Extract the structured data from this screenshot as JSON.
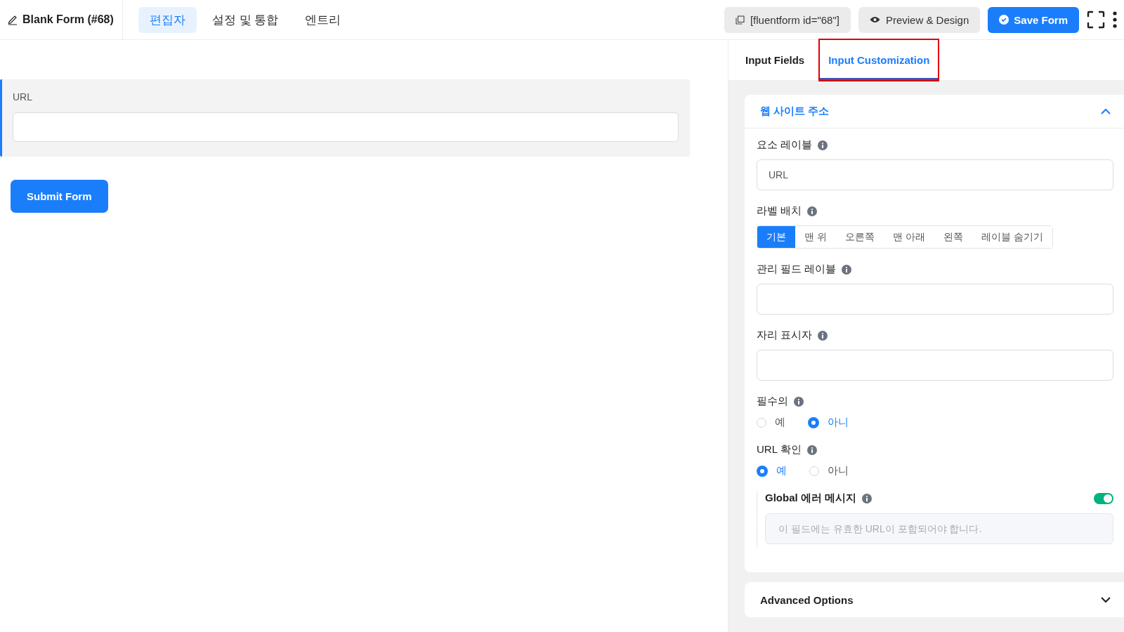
{
  "header": {
    "title": "Blank Form (#68)",
    "nav": [
      {
        "label": "편집자",
        "selected": true
      },
      {
        "label": "설정 및 통합",
        "selected": false
      },
      {
        "label": "엔트리",
        "selected": false
      }
    ],
    "shortcode": "[fluentform id=\"68\"]",
    "preview_button": "Preview & Design",
    "save_button": "Save Form"
  },
  "form_preview": {
    "field_label": "URL",
    "submit_button": "Submit Form"
  },
  "sidebar": {
    "tabs": [
      {
        "label": "Input Fields",
        "selected": false,
        "highlighted": false
      },
      {
        "label": "Input Customization",
        "selected": true,
        "highlighted": true
      }
    ],
    "section": {
      "title": "웹 사이트 주소",
      "expanded": true,
      "settings": [
        {
          "kind": "text",
          "label": "요소 레이블",
          "value": "URL"
        },
        {
          "kind": "segmented",
          "label": "라벨 배치",
          "options": [
            {
              "label": "기본",
              "selected": true
            },
            {
              "label": "맨 위",
              "selected": false
            },
            {
              "label": "오른쪽",
              "selected": false
            },
            {
              "label": "맨 아래",
              "selected": false
            },
            {
              "label": "왼쪽",
              "selected": false
            },
            {
              "label": "레이블 숨기기",
              "selected": false
            }
          ]
        },
        {
          "kind": "text",
          "label": "관리 필드 레이블"
        },
        {
          "kind": "text",
          "label": "자리 표시자"
        },
        {
          "kind": "radio",
          "label": "필수의",
          "options": [
            {
              "label": "예",
              "selected": false
            },
            {
              "label": "아니",
              "selected": true
            }
          ]
        },
        {
          "kind": "radio",
          "label": "URL 확인",
          "options": [
            {
              "label": "예",
              "selected": true
            },
            {
              "label": "아니",
              "selected": false
            }
          ]
        },
        {
          "kind": "toggle_message",
          "label": "Global 에러 메시지",
          "on": true,
          "placeholder": "이 필드에는 유효한 URL이 포함되어야 합니다."
        }
      ]
    },
    "advanced_section": {
      "title": "Advanced Options",
      "expanded": false
    }
  }
}
